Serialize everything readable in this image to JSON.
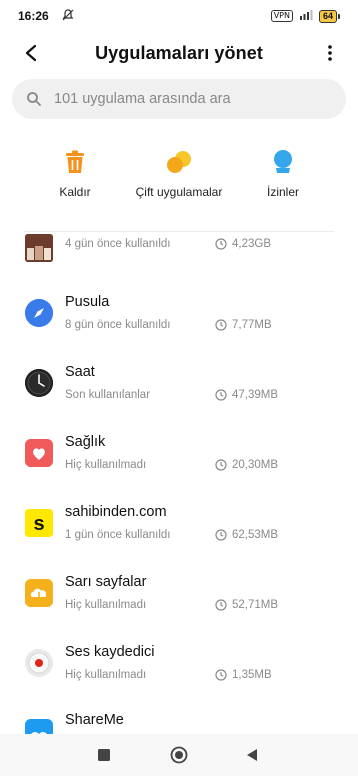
{
  "status_bar": {
    "time": "16:26",
    "vpn": "VPN",
    "battery": "64"
  },
  "header": {
    "title": "Uygulamaları yönet"
  },
  "search": {
    "placeholder": "101 uygulama arasında ara"
  },
  "actions": [
    {
      "label": "Kaldır",
      "icon": "trash-icon",
      "color": "#f5921e"
    },
    {
      "label": "Çift uygulamalar",
      "icon": "dual-apps-icon",
      "color": "#f6b81e"
    },
    {
      "label": "İzinler",
      "icon": "permissions-icon",
      "color": "#35a6ea"
    }
  ],
  "apps": [
    {
      "name": "",
      "usage": "4 gün önce kullanıldı",
      "size": "4,23GB",
      "icon": "photo-thumb-icon"
    },
    {
      "name": "Pusula",
      "usage": "8 gün önce kullanıldı",
      "size": "7,77MB",
      "icon": "compass-icon",
      "color": "#3a7bea"
    },
    {
      "name": "Saat",
      "usage": "Son kullanılanlar",
      "size": "47,39MB",
      "icon": "clock-app-icon",
      "color": "#222222"
    },
    {
      "name": "Sağlık",
      "usage": "Hiç kullanılmadı",
      "size": "20,30MB",
      "icon": "health-icon",
      "color": "#f05a5a"
    },
    {
      "name": "sahibinden.com",
      "usage": "1 gün önce kullanıldı",
      "size": "62,53MB",
      "icon": "sahibinden-icon",
      "color": "#ffe800"
    },
    {
      "name": "Sarı sayfalar",
      "usage": "Hiç kullanılmadı",
      "size": "52,71MB",
      "icon": "yellow-pages-icon",
      "color": "#f5b01e"
    },
    {
      "name": "Ses kaydedici",
      "usage": "Hiç kullanılmadı",
      "size": "1,35MB",
      "icon": "recorder-icon",
      "color": "#e2231a"
    },
    {
      "name": "ShareMe",
      "usage": "",
      "size": "",
      "icon": "shareme-icon",
      "color": "#1d9bf0"
    }
  ]
}
